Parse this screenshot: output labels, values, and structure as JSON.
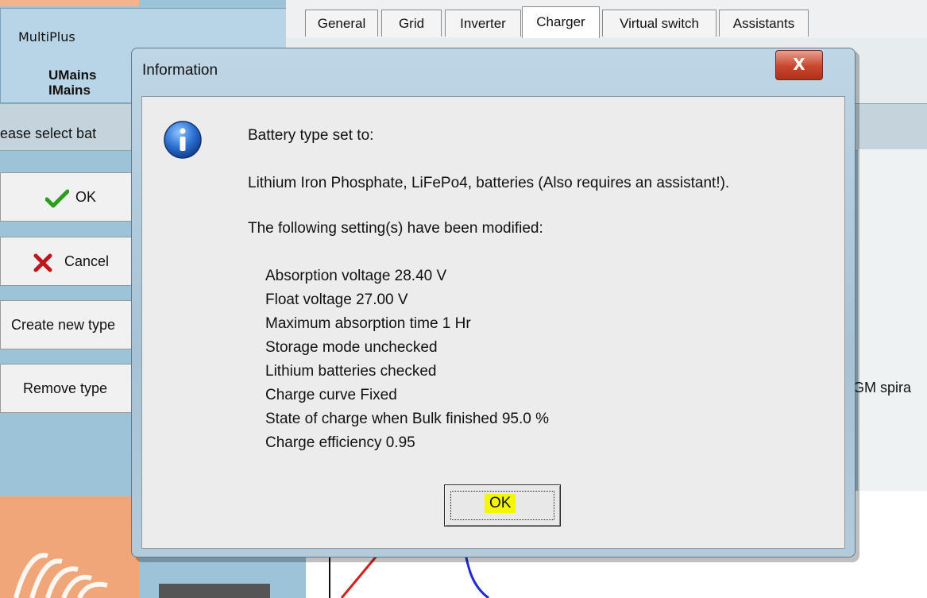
{
  "background": {
    "device_panel": {
      "title": "MultiPlus",
      "umains": "UMains",
      "imains": "IMains"
    },
    "select_prompt": "ease select bat",
    "buttons": {
      "ok": "OK",
      "cancel": "Cancel",
      "create_new_type": "Create new type",
      "remove_type": "Remove type"
    },
    "tabs": [
      "General",
      "Grid",
      "Inverter",
      "Charger",
      "Virtual switch",
      "Assistants"
    ],
    "active_tab": "Charger",
    "list_item_partial": "AGM spira"
  },
  "dialog": {
    "title": "Information",
    "close_label": "X",
    "icon": "info-icon",
    "line1": "Battery type set to:",
    "line2": "Lithium Iron Phosphate, LiFePo4, batteries (Also requires an assistant!).",
    "line3": "The following setting(s) have been modified:",
    "settings": [
      "Absorption voltage 28.40 V",
      "Float voltage 27.00 V",
      "Maximum absorption time 1 Hr",
      "Storage mode unchecked",
      "Lithium batteries checked",
      "Charge curve Fixed",
      "State of charge when Bulk finished 95.0 %",
      "Charge efficiency 0.95"
    ],
    "ok_label": "OK"
  },
  "colors": {
    "highlight": "#f4f700",
    "close_button": "#c9452d",
    "checkmark": "#2a9d1a",
    "cancel_x": "#c0161b"
  }
}
